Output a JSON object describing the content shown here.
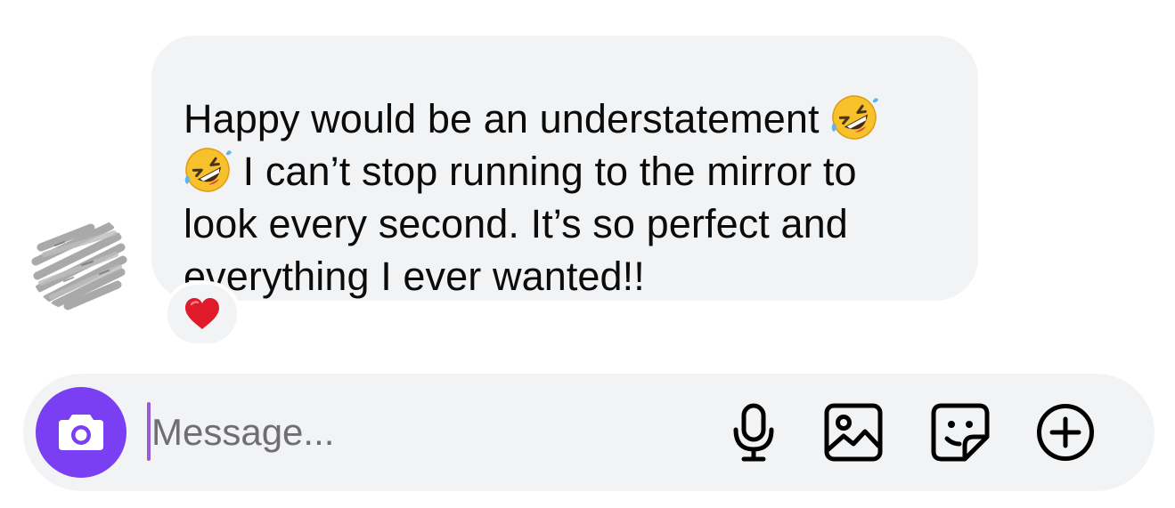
{
  "conversation": {
    "message": {
      "lines": [
        "Happy would be an understatement",
        "I can’t stop running to the mirror to",
        "look every second. It’s so perfect and",
        "everything I ever wanted!!"
      ],
      "emoji_name": "rolling-on-the-floor-laughing",
      "reaction": "heart"
    },
    "avatar": "scribbled-out-avatar"
  },
  "composer": {
    "placeholder": "Message...",
    "value": "",
    "accent": "#7a3ff2",
    "icons": [
      "camera-icon",
      "microphone-icon",
      "image-icon",
      "sticker-icon",
      "plus-icon"
    ]
  },
  "colors": {
    "bubble": "#f2f3f5",
    "text": "#0b0b0b",
    "camera_button": "#7a3ff2",
    "heart": "#e0192b"
  }
}
